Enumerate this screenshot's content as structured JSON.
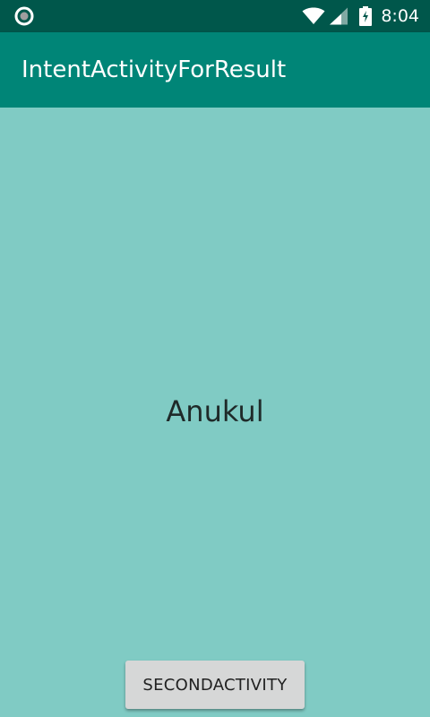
{
  "status_bar": {
    "left_icon": "circle-notification-icon",
    "icons": [
      "wifi-icon",
      "signal-icon",
      "battery-charging-icon"
    ],
    "time": "8:04"
  },
  "app_bar": {
    "title": "IntentActivityForResult",
    "color": "#008577"
  },
  "main": {
    "text": "Anukul",
    "background": "#80cbc4"
  },
  "button": {
    "label": "SECONDACTIVITY"
  }
}
